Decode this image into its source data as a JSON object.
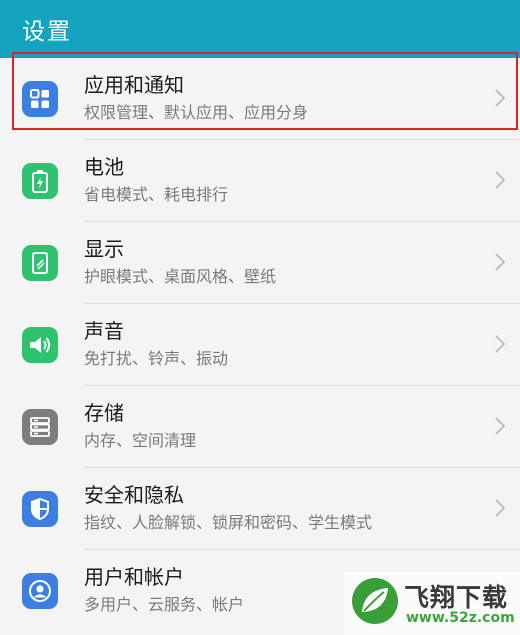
{
  "header": {
    "title": "设置"
  },
  "colors": {
    "header_bg": "#14a4c0",
    "highlight_border": "#d8232a",
    "icon_blue": "#3d7fe0",
    "icon_green": "#2fc36f",
    "icon_gray": "#7d7d7d"
  },
  "settings": {
    "items": [
      {
        "label": "应用和通知",
        "sub": "权限管理、默认应用、应用分身",
        "icon": "apps-grid-icon",
        "color": "#3d7fe0"
      },
      {
        "label": "电池",
        "sub": "省电模式、耗电排行",
        "icon": "battery-icon",
        "color": "#2fc36f"
      },
      {
        "label": "显示",
        "sub": "护眼模式、桌面风格、壁纸",
        "icon": "display-icon",
        "color": "#2fc36f"
      },
      {
        "label": "声音",
        "sub": "免打扰、铃声、振动",
        "icon": "speaker-icon",
        "color": "#2fc36f"
      },
      {
        "label": "存储",
        "sub": "内存、空间清理",
        "icon": "storage-icon",
        "color": "#7d7d7d"
      },
      {
        "label": "安全和隐私",
        "sub": "指纹、人脸解锁、锁屏和密码、学生模式",
        "icon": "shield-icon",
        "color": "#3d7fe0"
      },
      {
        "label": "用户和帐户",
        "sub": "多用户、云服务、帐户",
        "icon": "user-icon",
        "color": "#3d7fe0"
      }
    ]
  },
  "watermark": {
    "name": "飞翔下载",
    "url": "www.52z.com"
  }
}
